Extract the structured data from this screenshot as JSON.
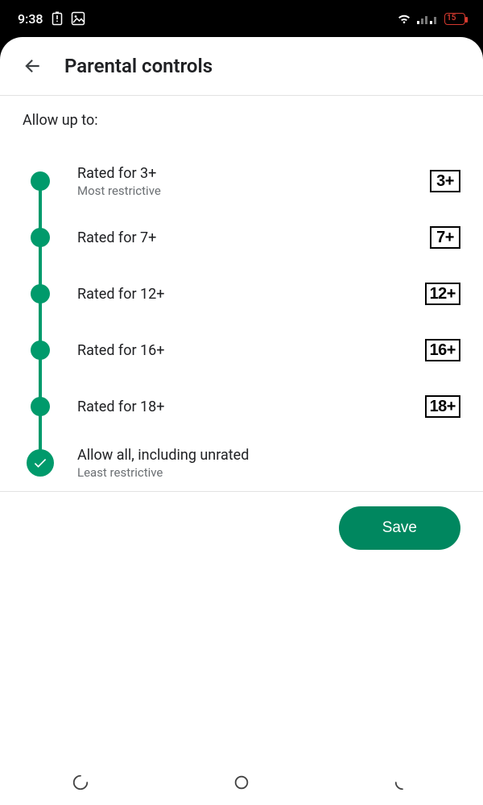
{
  "status_bar": {
    "time": "9:38",
    "battery": "15"
  },
  "header": {
    "title": "Parental controls"
  },
  "section": {
    "label": "Allow up to:"
  },
  "options": [
    {
      "label": "Rated for 3+",
      "sublabel": "Most restrictive",
      "badge": "3+",
      "selected": false
    },
    {
      "label": "Rated for 7+",
      "badge": "7+",
      "selected": false
    },
    {
      "label": "Rated for 12+",
      "badge": "12+",
      "selected": false
    },
    {
      "label": "Rated for 16+",
      "badge": "16+",
      "selected": false
    },
    {
      "label": "Rated for 18+",
      "badge": "18+",
      "selected": false
    },
    {
      "label": "Allow all, including unrated",
      "sublabel": "Least restrictive",
      "selected": true
    }
  ],
  "actions": {
    "save": "Save"
  },
  "colors": {
    "accent": "#009a6b",
    "save_button": "#00875f",
    "battery_low": "#d63a2f"
  }
}
